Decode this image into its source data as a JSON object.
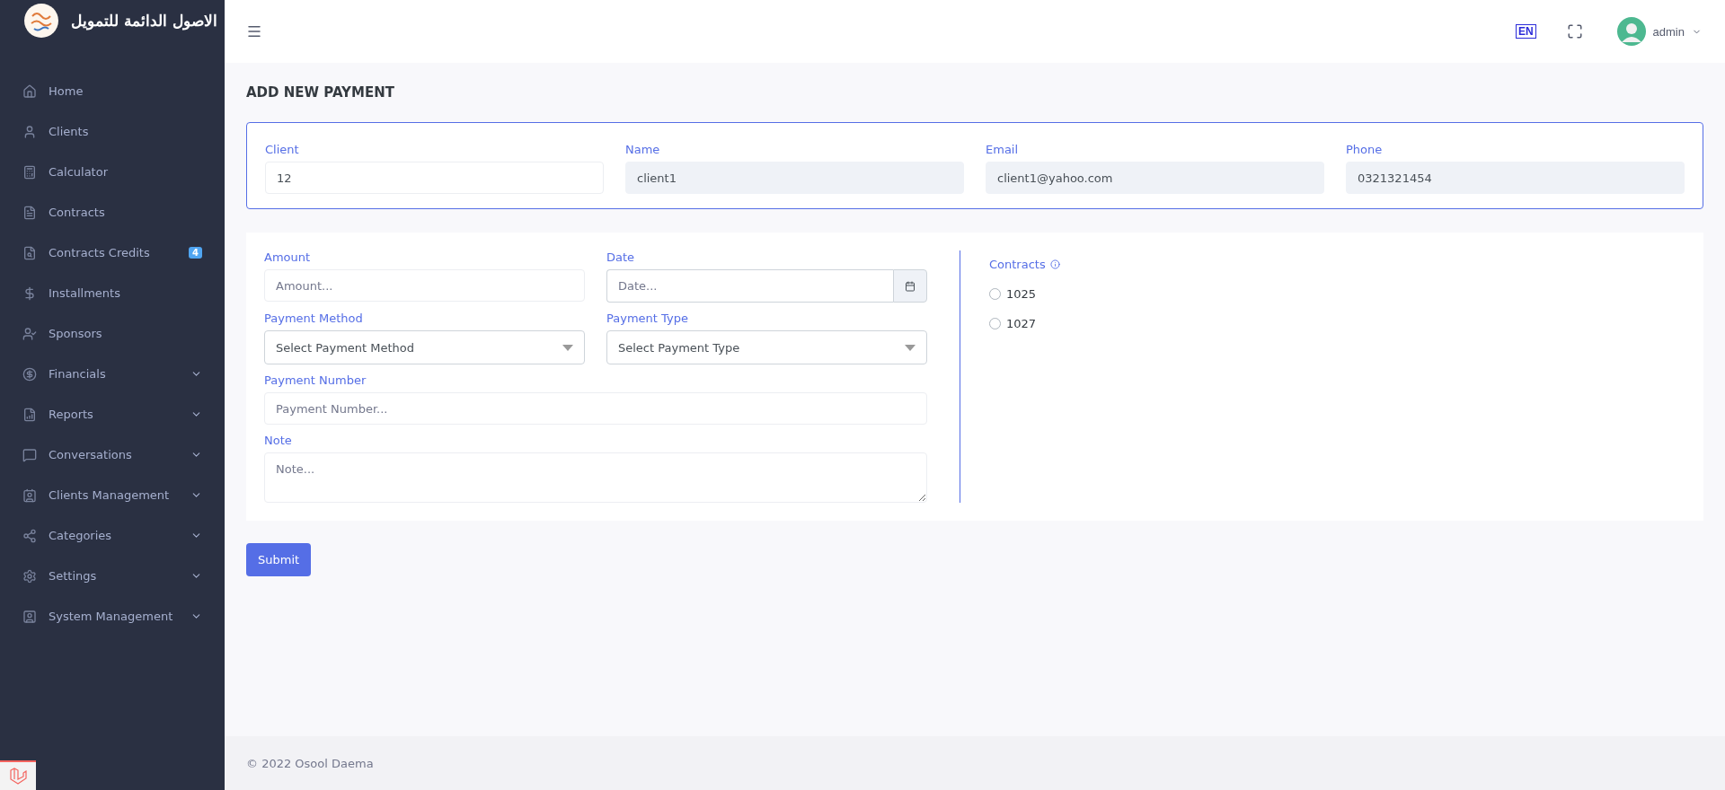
{
  "brand": {
    "title": "الاصول الدائمة للتمويل"
  },
  "sidebar": {
    "items": [
      {
        "kind": "home",
        "label": "Home",
        "has_submenu": false
      },
      {
        "kind": "user",
        "label": "Clients",
        "has_submenu": false
      },
      {
        "kind": "calculator",
        "label": "Calculator",
        "has_submenu": false
      },
      {
        "kind": "document",
        "label": "Contracts",
        "has_submenu": false
      },
      {
        "kind": "search-document",
        "label": "Contracts Credits",
        "badge": "4",
        "has_submenu": false
      },
      {
        "kind": "dollar",
        "label": "Installments",
        "has_submenu": false
      },
      {
        "kind": "user-check",
        "label": "Sponsors",
        "has_submenu": false
      },
      {
        "kind": "coin",
        "label": "Financials",
        "has_submenu": true
      },
      {
        "kind": "chart",
        "label": "Reports",
        "has_submenu": true
      },
      {
        "kind": "chat",
        "label": "Conversations",
        "has_submenu": true
      },
      {
        "kind": "contact",
        "label": "Clients Management",
        "has_submenu": true
      },
      {
        "kind": "share",
        "label": "Categories",
        "has_submenu": true
      },
      {
        "kind": "gear",
        "label": "Settings",
        "has_submenu": true
      },
      {
        "kind": "id",
        "label": "System Management",
        "has_submenu": true
      }
    ]
  },
  "topbar": {
    "language": "EN",
    "user": "admin"
  },
  "page_title": "ADD NEW PAYMENT",
  "client_card": {
    "fields": [
      {
        "label": "Client",
        "value": "12",
        "readonly": false
      },
      {
        "label": "Name",
        "value": "client1",
        "readonly": true
      },
      {
        "label": "Email",
        "value": "client1@yahoo.com",
        "readonly": true
      },
      {
        "label": "Phone",
        "value": "0321321454",
        "readonly": true
      }
    ]
  },
  "payment_form": {
    "fields": [
      {
        "kind": "text",
        "label": "Amount",
        "placeholder": "Amount..."
      },
      {
        "kind": "date",
        "label": "Date",
        "placeholder": "Date..."
      },
      {
        "kind": "select",
        "label": "Payment Method",
        "value": "Select Payment Method"
      },
      {
        "kind": "select",
        "label": "Payment Type",
        "value": "Select Payment Type"
      },
      {
        "kind": "widetext",
        "label": "Payment Number",
        "placeholder": "Payment Number..."
      },
      {
        "kind": "textarea",
        "label": "Note",
        "placeholder": "Note..."
      }
    ],
    "contracts": {
      "label": "Contracts",
      "options": [
        {
          "label": "1025",
          "selected": false
        },
        {
          "label": "1027",
          "selected": false
        }
      ]
    }
  },
  "submit": "Submit",
  "footer": "© 2022 Osool Daema"
}
